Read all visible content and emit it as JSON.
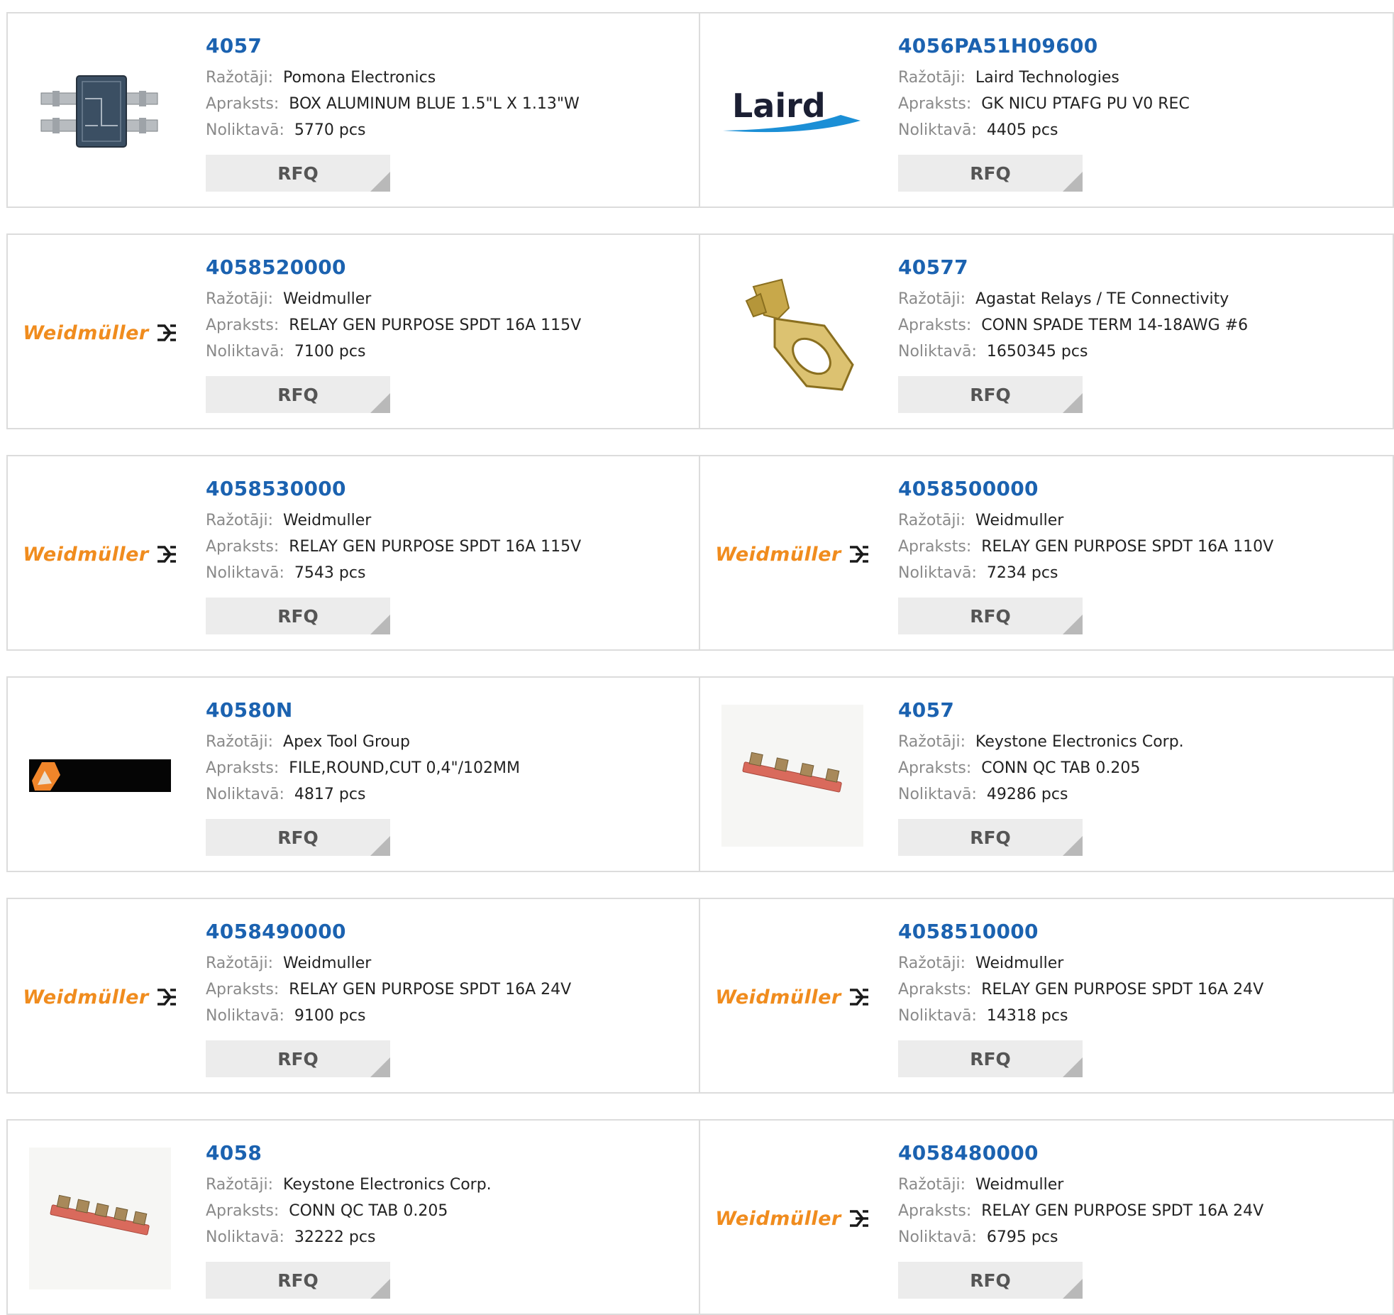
{
  "labels": {
    "manufacturer": "Ražotāji:",
    "description": "Apraksts:",
    "stock": "Noliktavā:",
    "rfq": "RFQ"
  },
  "logo_texts": {
    "laird": "Laird",
    "weidmuller": "Weidmüller"
  },
  "colors": {
    "part_number": "#1b62b0",
    "label": "#8a8a8a",
    "weidmuller_orange": "#f08c1e",
    "laird_blue": "#1b8fd6",
    "rfq_bg": "#ececec",
    "border": "#dcdcdc"
  },
  "products": [
    {
      "part": "4057",
      "manufacturer": "Pomona Electronics",
      "description": "BOX ALUMINUM BLUE 1.5\"L X 1.13\"W",
      "stock": "5770 pcs",
      "image": "aluminum-box-image"
    },
    {
      "part": "4056PA51H09600",
      "manufacturer": "Laird Technologies",
      "description": "GK NICU PTAFG PU V0 REC",
      "stock": "4405 pcs",
      "image": "laird-logo"
    },
    {
      "part": "4058520000",
      "manufacturer": "Weidmuller",
      "description": "RELAY GEN PURPOSE SPDT 16A 115V",
      "stock": "7100 pcs",
      "image": "weidmuller-logo"
    },
    {
      "part": "40577",
      "manufacturer": "Agastat Relays / TE Connectivity",
      "description": "CONN SPADE TERM 14-18AWG #6",
      "stock": "1650345 pcs",
      "image": "spade-terminal-image"
    },
    {
      "part": "4058530000",
      "manufacturer": "Weidmuller",
      "description": "RELAY GEN PURPOSE SPDT 16A 115V",
      "stock": "7543 pcs",
      "image": "weidmuller-logo"
    },
    {
      "part": "4058500000",
      "manufacturer": "Weidmuller",
      "description": "RELAY GEN PURPOSE SPDT 16A 110V",
      "stock": "7234 pcs",
      "image": "weidmuller-logo"
    },
    {
      "part": "40580N",
      "manufacturer": "Apex Tool Group",
      "description": "FILE,ROUND,CUT 0,4\"/102MM",
      "stock": "4817 pcs",
      "image": "apex-logo"
    },
    {
      "part": "4057",
      "manufacturer": "Keystone Electronics Corp.",
      "description": "CONN QC TAB 0.205",
      "stock": "49286 pcs",
      "image": "qc-tab-strip-image"
    },
    {
      "part": "4058490000",
      "manufacturer": "Weidmuller",
      "description": "RELAY GEN PURPOSE SPDT 16A 24V",
      "stock": "9100 pcs",
      "image": "weidmuller-logo"
    },
    {
      "part": "4058510000",
      "manufacturer": "Weidmuller",
      "description": "RELAY GEN PURPOSE SPDT 16A 24V",
      "stock": "14318 pcs",
      "image": "weidmuller-logo"
    },
    {
      "part": "4058",
      "manufacturer": "Keystone Electronics Corp.",
      "description": "CONN QC TAB 0.205",
      "stock": "32222 pcs",
      "image": "qc-tab-strip-long-image"
    },
    {
      "part": "4058480000",
      "manufacturer": "Weidmuller",
      "description": "RELAY GEN PURPOSE SPDT 16A 24V",
      "stock": "6795 pcs",
      "image": "weidmuller-logo"
    }
  ]
}
